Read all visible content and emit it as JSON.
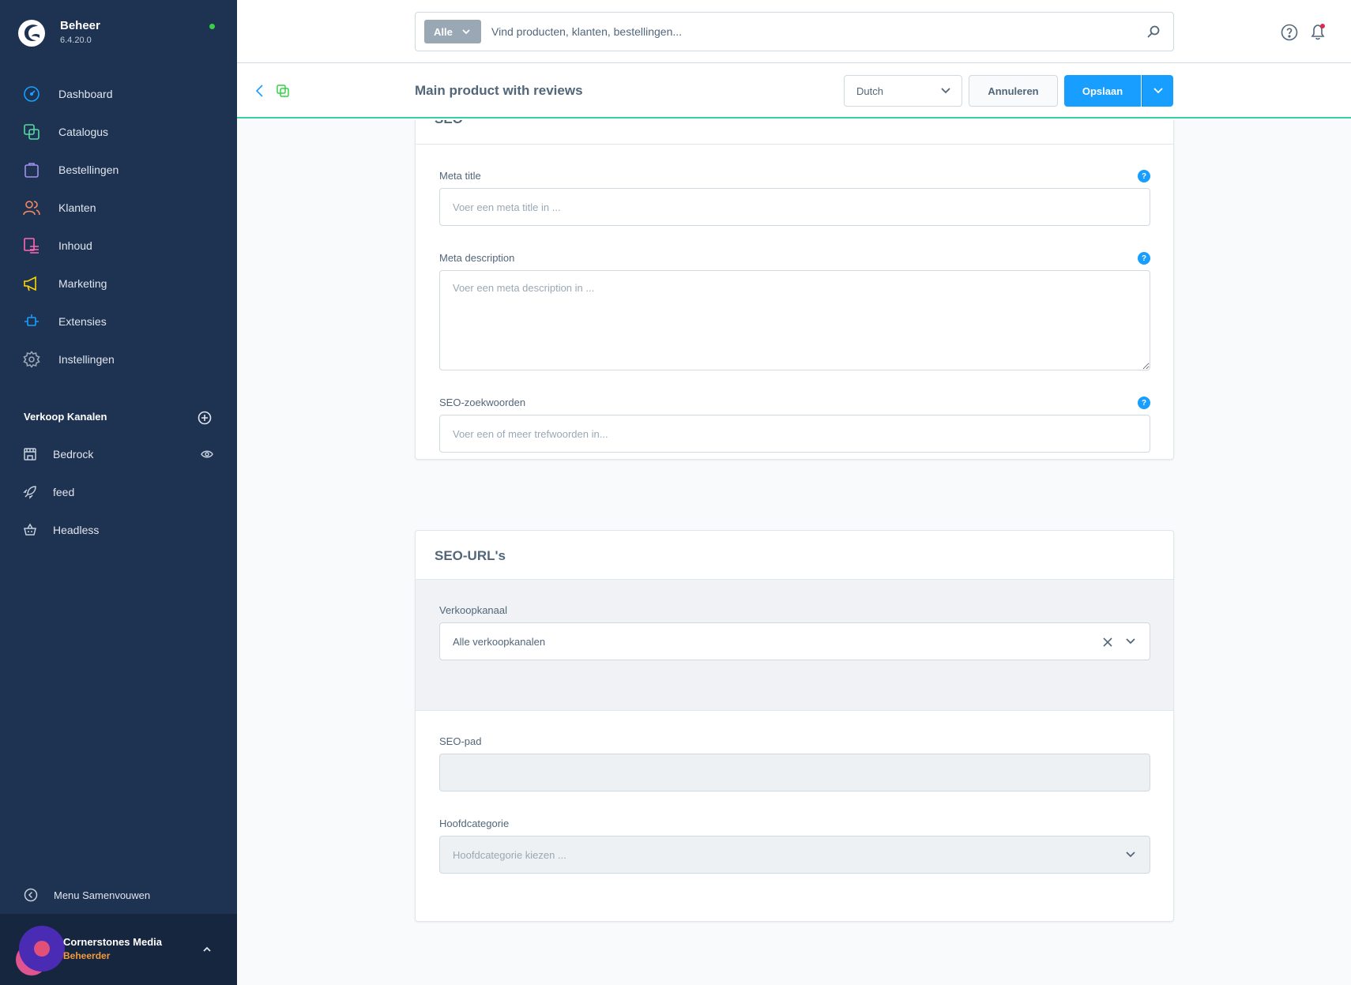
{
  "app": {
    "name": "Beheer",
    "version": "6.4.20.0",
    "status_color": "#37d046"
  },
  "sidebar": {
    "items": [
      {
        "label": "Dashboard",
        "icon": "dashboard-icon",
        "color": "#189eff"
      },
      {
        "label": "Catalogus",
        "icon": "catalog-icon",
        "color": "#57d9a3"
      },
      {
        "label": "Bestellingen",
        "icon": "orders-icon",
        "color": "#a092f0"
      },
      {
        "label": "Klanten",
        "icon": "customers-icon",
        "color": "#f88962"
      },
      {
        "label": "Inhoud",
        "icon": "content-icon",
        "color": "#ff68b4"
      },
      {
        "label": "Marketing",
        "icon": "marketing-icon",
        "color": "#ffd700"
      },
      {
        "label": "Extensies",
        "icon": "extensions-icon",
        "color": "#189eff"
      },
      {
        "label": "Instellingen",
        "icon": "settings-icon",
        "color": "#9aa8b5"
      }
    ],
    "sales_channels_heading": "Verkoop Kanalen",
    "sales_channels": [
      {
        "label": "Bedrock",
        "icon": "storefront-icon"
      },
      {
        "label": "feed",
        "icon": "rocket-icon"
      },
      {
        "label": "Headless",
        "icon": "basket-icon"
      }
    ],
    "collapse_label": "Menu Samenvouwen",
    "user": {
      "name": "Cornerstones Media",
      "role": "Beheerder"
    }
  },
  "search": {
    "type_label": "Alle",
    "placeholder": "Vind producten, klanten, bestellingen..."
  },
  "smartbar": {
    "title": "Main product with reviews",
    "language": "Dutch",
    "cancel_label": "Annuleren",
    "save_label": "Opslaan"
  },
  "seo_card": {
    "title": "SEO",
    "meta_title_label": "Meta title",
    "meta_title_placeholder": "Voer een meta title in ...",
    "meta_description_label": "Meta description",
    "meta_description_placeholder": "Voer een meta description in ...",
    "keywords_label": "SEO-zoekwoorden",
    "keywords_placeholder": "Voer een of meer trefwoorden in...",
    "help_glyph": "?"
  },
  "seo_urls_card": {
    "title": "SEO-URL's",
    "sales_channel_label": "Verkoopkanaal",
    "sales_channel_value": "Alle verkoopkanalen",
    "seo_path_label": "SEO-pad",
    "main_category_label": "Hoofdcategorie",
    "main_category_placeholder": "Hoofdcategorie kiezen ..."
  }
}
